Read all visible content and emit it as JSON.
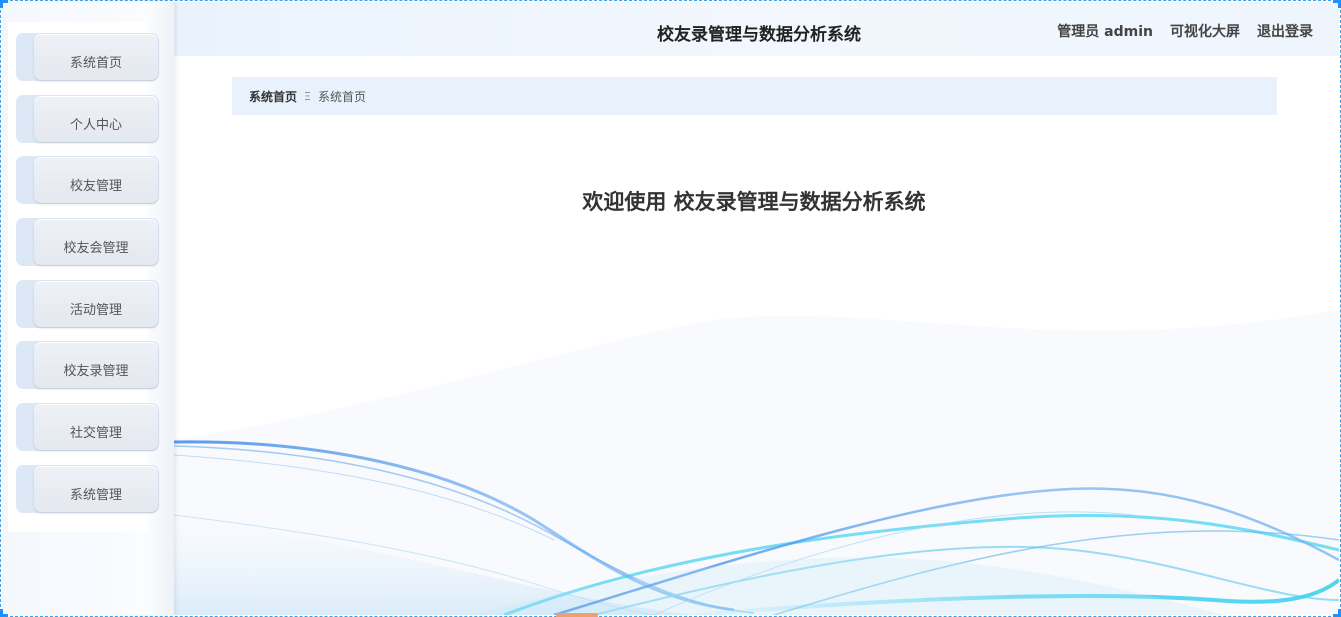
{
  "header": {
    "title": "校友录管理与数据分析系统",
    "user_label": "管理员 admin",
    "dashboard_link": "可视化大屏",
    "logout_link": "退出登录"
  },
  "sidebar": {
    "items": [
      {
        "label": "系统首页"
      },
      {
        "label": "个人中心"
      },
      {
        "label": "校友管理"
      },
      {
        "label": "校友会管理"
      },
      {
        "label": "活动管理"
      },
      {
        "label": "校友录管理"
      },
      {
        "label": "社交管理"
      },
      {
        "label": "系统管理"
      }
    ]
  },
  "breadcrumb": {
    "home": "系统首页",
    "separator": "Ξ",
    "current": "系统首页"
  },
  "main": {
    "welcome": "欢迎使用 校友录管理与数据分析系统"
  },
  "colors": {
    "accent": "#1e90ff",
    "header_bg": "#eaf3fd",
    "breadcrumb_bg": "#e9f2fc",
    "wave_blue": "#4a90e8",
    "wave_cyan": "#3fd0f0"
  }
}
